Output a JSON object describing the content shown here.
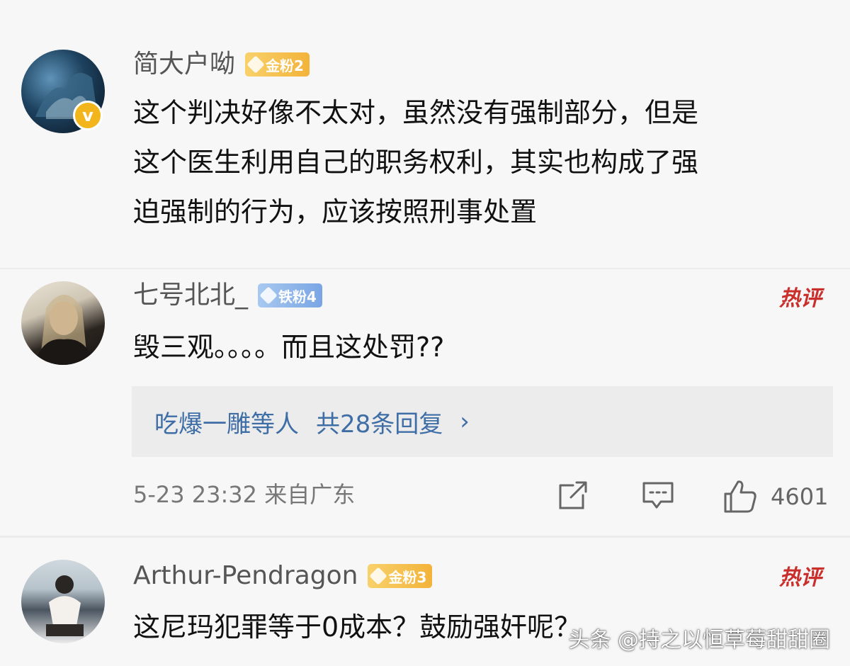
{
  "comments": [
    {
      "username": "简大户呦",
      "badge": "金粉2",
      "text_lines": [
        "这个判决好像不太对，虽然没有强制部分，但是",
        "这个医生利用自己的职务权利，其实也构成了强",
        "迫强制的行为，应该按照刑事处置"
      ],
      "verified_mark": "v"
    },
    {
      "username": "七号北北_",
      "badge": "铁粉4",
      "hot_label": "热评",
      "text": "毁三观。。。。而且这处罚??",
      "reply": {
        "name": "吃爆一雕等人",
        "count": "共28条回复",
        "chevron": "›"
      },
      "meta": "5-23 23:32 来自广东",
      "likes": "4601"
    },
    {
      "username": "Arthur-Pendragon",
      "badge": "金粉3",
      "hot_label": "热评",
      "text": "这尼玛犯罪等于0成本？鼓励强奸呢？"
    }
  ],
  "watermark": "头条 @持之以恒草莓甜甜圈",
  "icons": {
    "share": "share-icon",
    "comment": "comment-icon",
    "like": "like-icon",
    "verified": "verified-icon"
  }
}
